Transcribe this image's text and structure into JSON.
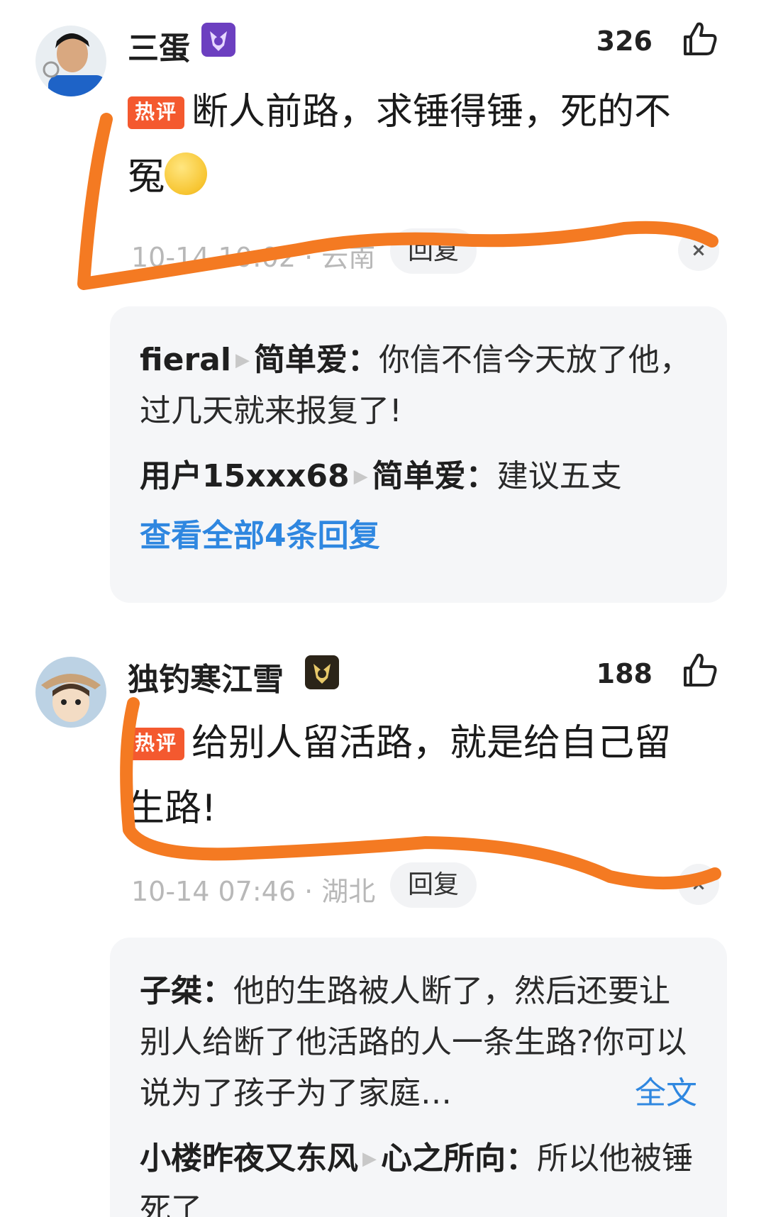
{
  "comments": [
    {
      "username": "三蛋",
      "likes": "326",
      "hot_tag": "热评",
      "text": "断人前路，求锤得锤，死的不冤",
      "time_location": "10-14 10:02 · 云南",
      "reply_label": "回复",
      "close_label": "×",
      "replies": [
        {
          "from": "fieral",
          "to": "简单爱",
          "colon": "：",
          "text": "你信不信今天放了他，过几天就来报复了!"
        },
        {
          "from": "用户15xxx68",
          "to": "简单爱",
          "colon": "：",
          "text": "建议五支"
        }
      ],
      "view_all": "查看全部4条回复"
    },
    {
      "username": "独钓寒江雪",
      "likes": "188",
      "hot_tag": "热评",
      "text": "给别人留活路，就是给自己留生路!",
      "time_location": "10-14 07:46 · 湖北",
      "reply_label": "回复",
      "close_label": "×",
      "replies": [
        {
          "from": "子桀",
          "colon": "：",
          "text": "他的生路被人断了，然后还要让别人给断了他活路的人一条生路?你可以说为了孩子为了家庭…",
          "more": "全文"
        },
        {
          "from": "小楼昨夜又东风",
          "to": "心之所向",
          "colon": "：",
          "text": "所以他被锤死了"
        }
      ]
    }
  ],
  "colors": {
    "hot_tag": "#f4592f",
    "link": "#2f87e0",
    "scribble": "#f47a22"
  },
  "icons": [
    "thumbs-up-icon",
    "medal-badge-icon",
    "smile-emoji-icon",
    "close-icon"
  ]
}
